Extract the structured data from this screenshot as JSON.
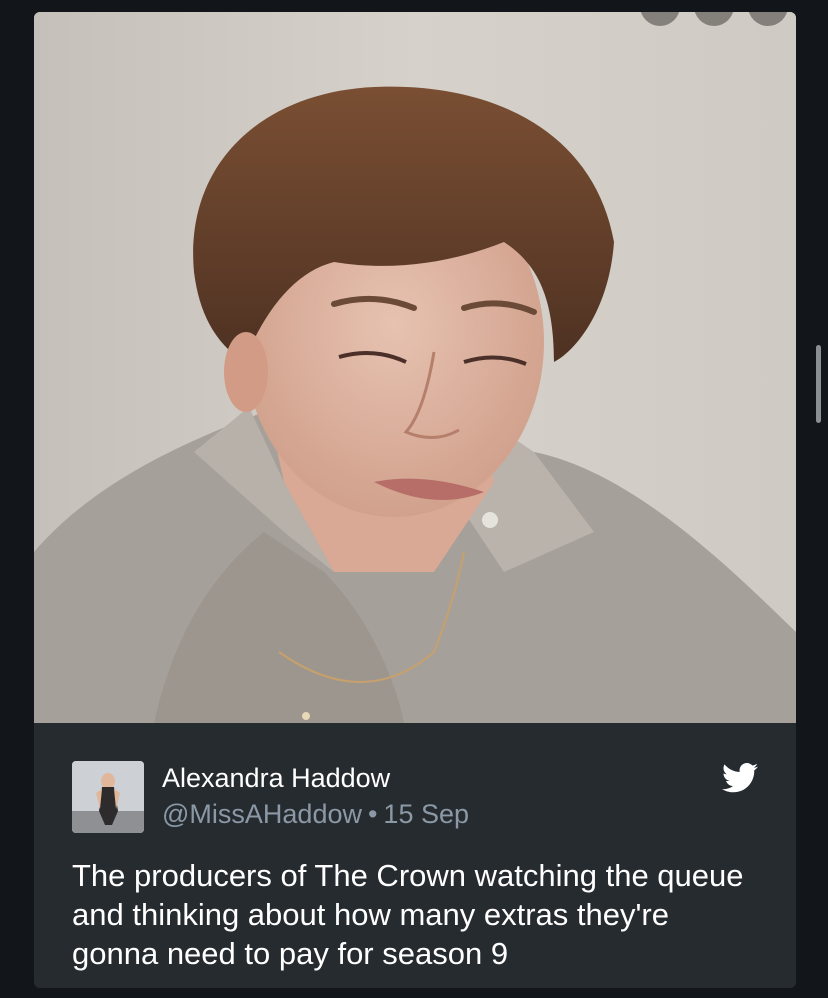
{
  "tweet": {
    "author_name": "Alexandra Haddow",
    "handle": "@MissAHaddow",
    "separator": "•",
    "date": "15 Sep",
    "text": "The producers of The Crown watching the queue and thinking about how many extras they're gonna need to pay for season 9"
  },
  "icons": {
    "platform": "twitter-bird-icon"
  },
  "colors": {
    "background": "#121519",
    "card": "#262b30",
    "primary_text": "#ffffff",
    "secondary_text": "#8b98a5",
    "bird": "#ffffff"
  }
}
